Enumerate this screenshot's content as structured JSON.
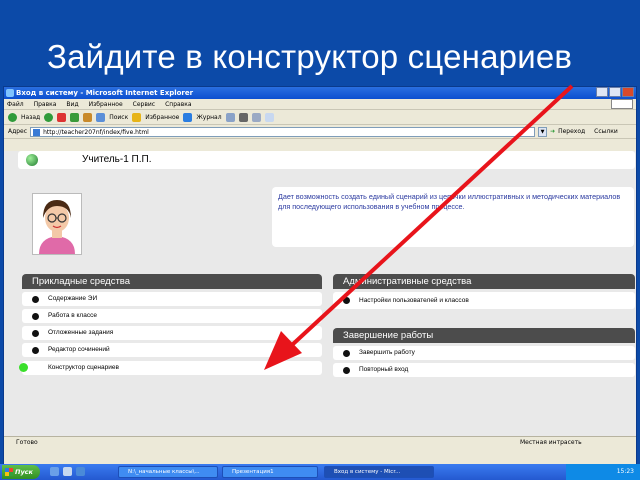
{
  "slide": {
    "title": "Зайдите в конструктор сценариев"
  },
  "window": {
    "title": "Вход в систему - Microsoft Internet Explorer",
    "menu": [
      "Файл",
      "Правка",
      "Вид",
      "Избранное",
      "Сервис",
      "Справка"
    ],
    "toolbar": {
      "back": "Назад",
      "search": "Поиск",
      "favorites": "Избранное",
      "journal": "Журнал"
    },
    "address": {
      "label": "Адрес",
      "url": "http://teacher207nf/index/five.html",
      "go": "Переход",
      "links": "Ссылки"
    }
  },
  "page": {
    "user": "Учитель-1  П.П.",
    "info": "Дает возможность создать единый сценарий из цепочки иллюстративных и методических материалов для последующего использования в учебном процессе.",
    "applied": {
      "title": "Прикладные средства",
      "items": [
        "Содержание ЭИ",
        "Работа в классе",
        "Отложенные задания",
        "Редактор сочинений",
        "Конструктор сценариев"
      ]
    },
    "admin": {
      "title": "Административные средства",
      "items": [
        "Настройки пользователей и классов"
      ]
    },
    "finish": {
      "title": "Завершение работы",
      "items": [
        "Завершить работу",
        "Повторный вход"
      ]
    }
  },
  "status": {
    "left": "Готово",
    "right": "Местная интрасеть"
  },
  "taskbar": {
    "start": "Пуск",
    "tasks": [
      "N:\\_начальные классы\\...",
      "Презентация1",
      "Вход в систему - Micr..."
    ],
    "clock": "15:23"
  },
  "colors": {
    "background": "#0c4aa8",
    "arrow": "#e8141b",
    "active_dot": "#3adf2b"
  }
}
